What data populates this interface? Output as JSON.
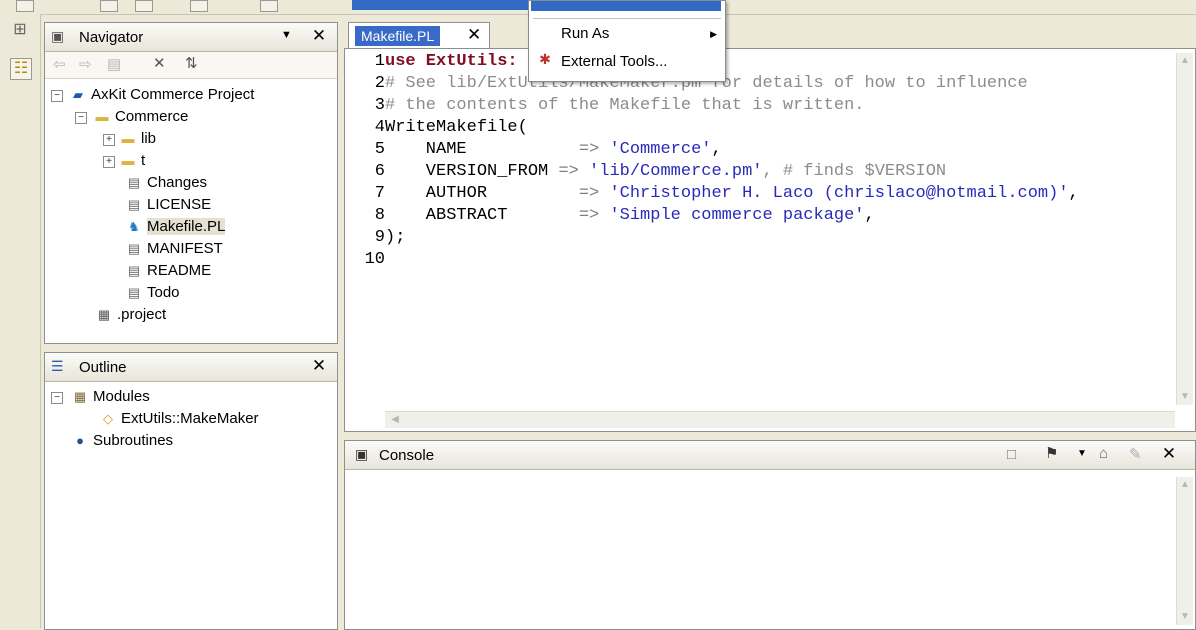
{
  "navigator": {
    "title": "Navigator",
    "project": "AxKit Commerce Project",
    "items": [
      {
        "label": "Commerce",
        "icon": "folder-open-icon"
      },
      {
        "label": "lib",
        "icon": "folder-icon"
      },
      {
        "label": "t",
        "icon": "folder-icon"
      },
      {
        "label": "Changes",
        "icon": "file-icon"
      },
      {
        "label": "LICENSE",
        "icon": "file-icon"
      },
      {
        "label": "Makefile.PL",
        "icon": "perl-camel-icon"
      },
      {
        "label": "MANIFEST",
        "icon": "file-icon"
      },
      {
        "label": "README",
        "icon": "file-icon"
      },
      {
        "label": "Todo",
        "icon": "file-icon"
      },
      {
        "label": ".project",
        "icon": "project-file-icon"
      }
    ]
  },
  "outline": {
    "title": "Outline",
    "modules_label": "Modules",
    "module_item": "ExtUtils::MakeMaker",
    "subroutines_label": "Subroutines"
  },
  "editor": {
    "tab_label": "Makefile.PL",
    "lines": [
      {
        "num": "1",
        "text": "use ExtUtils:"
      },
      {
        "num": "2",
        "text": "# See lib/ExtUtils/MakeMaker.pm for details of how to influence"
      },
      {
        "num": "3",
        "text": "# the contents of the Makefile that is written."
      },
      {
        "num": "4",
        "text": "WriteMakefile("
      },
      {
        "num": "5",
        "key": "    NAME         ",
        "arrow": "=>",
        "val": "'Commerce'",
        "tail": ","
      },
      {
        "num": "6",
        "key": "    VERSION_FROM ",
        "arrow": "=>",
        "val": "'lib/Commerce.pm'",
        "tail": ", # finds $VERSION"
      },
      {
        "num": "7",
        "key": "    AUTHOR       ",
        "arrow": "=>",
        "val": "'Christopher H. Laco (chrislaco@hotmail.com)'",
        "tail": ","
      },
      {
        "num": "8",
        "key": "    ABSTRACT     ",
        "arrow": "=>",
        "val": "'Simple commerce package'",
        "tail": ","
      },
      {
        "num": "9",
        "text": ");"
      },
      {
        "num": "10",
        "text": ""
      }
    ]
  },
  "console": {
    "title": "Console"
  },
  "context_menu": {
    "items": [
      {
        "label": "Run As",
        "icon": ""
      },
      {
        "label": "External Tools...",
        "icon": "external-tools-icon"
      }
    ]
  },
  "colors": {
    "selection": "#316ac5",
    "keyword": "#7f0d24",
    "comment": "#8c8c8c",
    "string": "#2a2ab9",
    "chrome": "#ece9d8"
  }
}
